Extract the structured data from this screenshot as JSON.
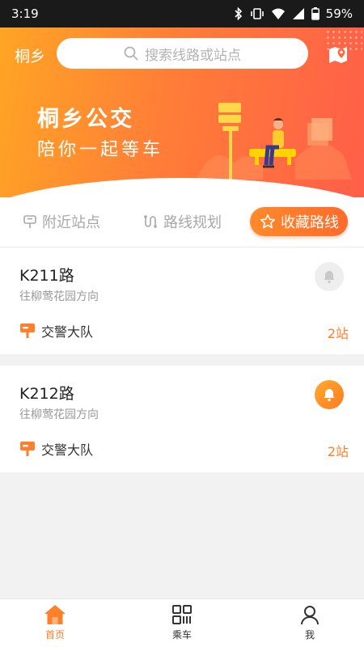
{
  "status_bar": {
    "time": "3:19",
    "battery": "59%"
  },
  "header": {
    "city": "桐乡",
    "search_placeholder": "搜索线路或站点",
    "title": "桐乡公交",
    "subtitle": "陪你一起等车",
    "icons": {
      "search": "search-icon",
      "map": "map-pin-icon"
    }
  },
  "tabs": [
    {
      "label": "附近站点",
      "icon": "bus-stop-icon",
      "active": false
    },
    {
      "label": "路线规划",
      "icon": "route-icon",
      "active": false
    },
    {
      "label": "收藏路线",
      "icon": "star-icon",
      "active": true
    }
  ],
  "routes": [
    {
      "name": "K211路",
      "direction": "往柳莺花园方向",
      "stop": "交警大队",
      "stops_away": "2站",
      "reminder_on": false
    },
    {
      "name": "K212路",
      "direction": "往柳莺花园方向",
      "stop": "交警大队",
      "stops_away": "2站",
      "reminder_on": true
    }
  ],
  "bottom_nav": [
    {
      "label": "首页",
      "icon": "home-icon",
      "active": true
    },
    {
      "label": "乘车",
      "icon": "qr-code-icon",
      "active": false
    },
    {
      "label": "我",
      "icon": "user-icon",
      "active": false
    }
  ],
  "colors": {
    "accent": "#ff7f2a",
    "gradient_start": "#ffa524",
    "gradient_end": "#ff5e49"
  }
}
